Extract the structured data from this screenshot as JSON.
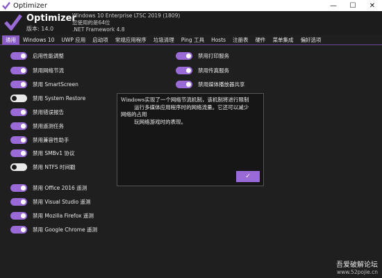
{
  "window": {
    "title": "Optimizer",
    "minimize": "—",
    "maximize": "☐",
    "close": "✕"
  },
  "header": {
    "app_name": "Optimizer",
    "version": "版本: 14.0",
    "sysinfo": [
      "Windows 10 Enterprise LTSC 2019 (1809)",
      "您使用的是64位",
      ".NET Framework 4.8"
    ]
  },
  "tabs": [
    "通用",
    "Windows 10",
    "UWP 应用",
    "启动项",
    "常规应用程序",
    "垃圾清理",
    "Ping 工具",
    "Hosts",
    "注册表",
    "硬件",
    "菜单集成",
    "偏好选项"
  ],
  "toggles_left": [
    {
      "label": "启用性能调整",
      "state": "on"
    },
    {
      "label": "禁用网络节流",
      "state": "on"
    },
    {
      "label": "禁用 SmartScreen",
      "state": "on"
    },
    {
      "label": "禁用 System Restore",
      "state": "off"
    },
    {
      "label": "禁用错误报告",
      "state": "on"
    },
    {
      "label": "禁用遥测任务",
      "state": "on"
    },
    {
      "label": "禁用兼容性助手",
      "state": "on"
    },
    {
      "label": "禁用 SMBv1 协议",
      "state": "on"
    },
    {
      "label": "禁用 NTFS 时间戳",
      "state": "off"
    },
    {
      "label": "禁用 Office 2016 遥测",
      "state": "on"
    },
    {
      "label": "禁用 Visual Studio 遥测",
      "state": "on"
    },
    {
      "label": "禁用 Mozilla Firefox 遥测",
      "state": "on"
    },
    {
      "label": "禁用 Google Chrome 遥测",
      "state": "on"
    }
  ],
  "toggles_right": [
    {
      "label": "禁用打印服务",
      "state": "on"
    },
    {
      "label": "禁用传真服务",
      "state": "on"
    },
    {
      "label": "禁用媒体播放器共享",
      "state": "on"
    }
  ],
  "dialog": {
    "message": "Windows实现了一个网络节流机制，该机制将进行限制\n        运行多媒体应用程序时的网络流量。它还可以减少\n网络的占用\n        玩网络游戏时的表现。",
    "ok": "✓"
  },
  "watermark": {
    "site_name": "吾爱破解论坛",
    "url": "www.52pojie.cn"
  },
  "colors": {
    "accent": "#9a6bd6",
    "background": "#1f1f1f",
    "tab_active": "#8a5cc6"
  }
}
